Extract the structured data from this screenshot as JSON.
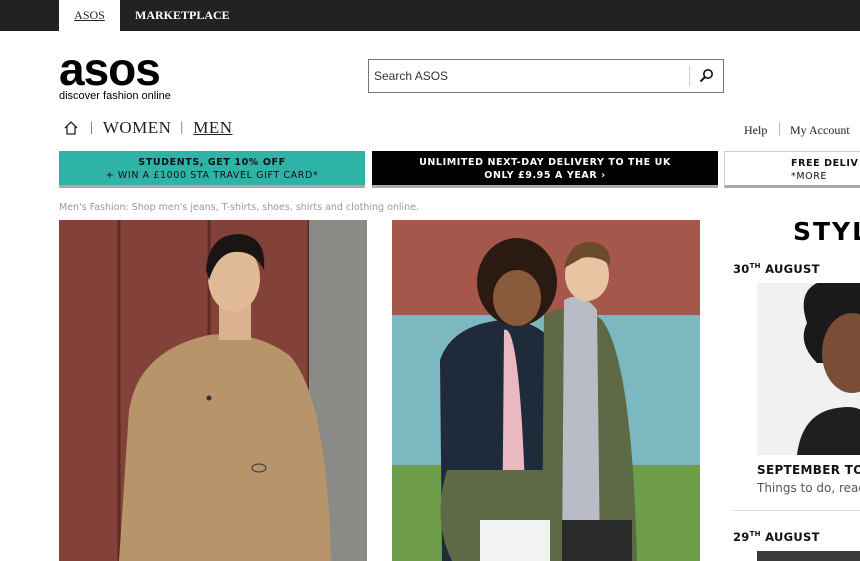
{
  "topbar": {
    "tab_asos": "ASOS",
    "tab_marketplace": "MARKETPLACE"
  },
  "logo": {
    "mark": "asos",
    "tagline": "discover fashion online"
  },
  "search": {
    "placeholder": "Search ASOS",
    "icon": "search-icon"
  },
  "nav": {
    "home_icon": "home-icon",
    "women": "WOMEN",
    "men": "MEN",
    "help": "Help",
    "my_account": "My Account"
  },
  "promos": {
    "students_line1": "STUDENTS, GET 10% OFF",
    "students_line2": "+ WIN A £1000 STA TRAVEL GIFT CARD*",
    "delivery_line1": "UNLIMITED NEXT-DAY DELIVERY TO THE UK",
    "delivery_line2": "ONLY £9.95 A YEAR ›",
    "free_line1": "FREE DELIV",
    "free_line2": "*MORE"
  },
  "seo_text": "Men's Fashion: Shop men's jeans, T-shirts, shoes, shirts and clothing online.",
  "style_feed": {
    "title": "STYL",
    "date1_day": "30",
    "date1_suffix": "TH",
    "date1_month": " AUGUST",
    "item1_headline": "SEPTEMBER TO",
    "item1_sub": "Things to do, read",
    "date2_day": "29",
    "date2_suffix": "TH",
    "date2_month": " AUGUST"
  },
  "colors": {
    "topbar": "#222222",
    "students_banner": "#2eb3a6",
    "delivery_banner": "#000000"
  }
}
